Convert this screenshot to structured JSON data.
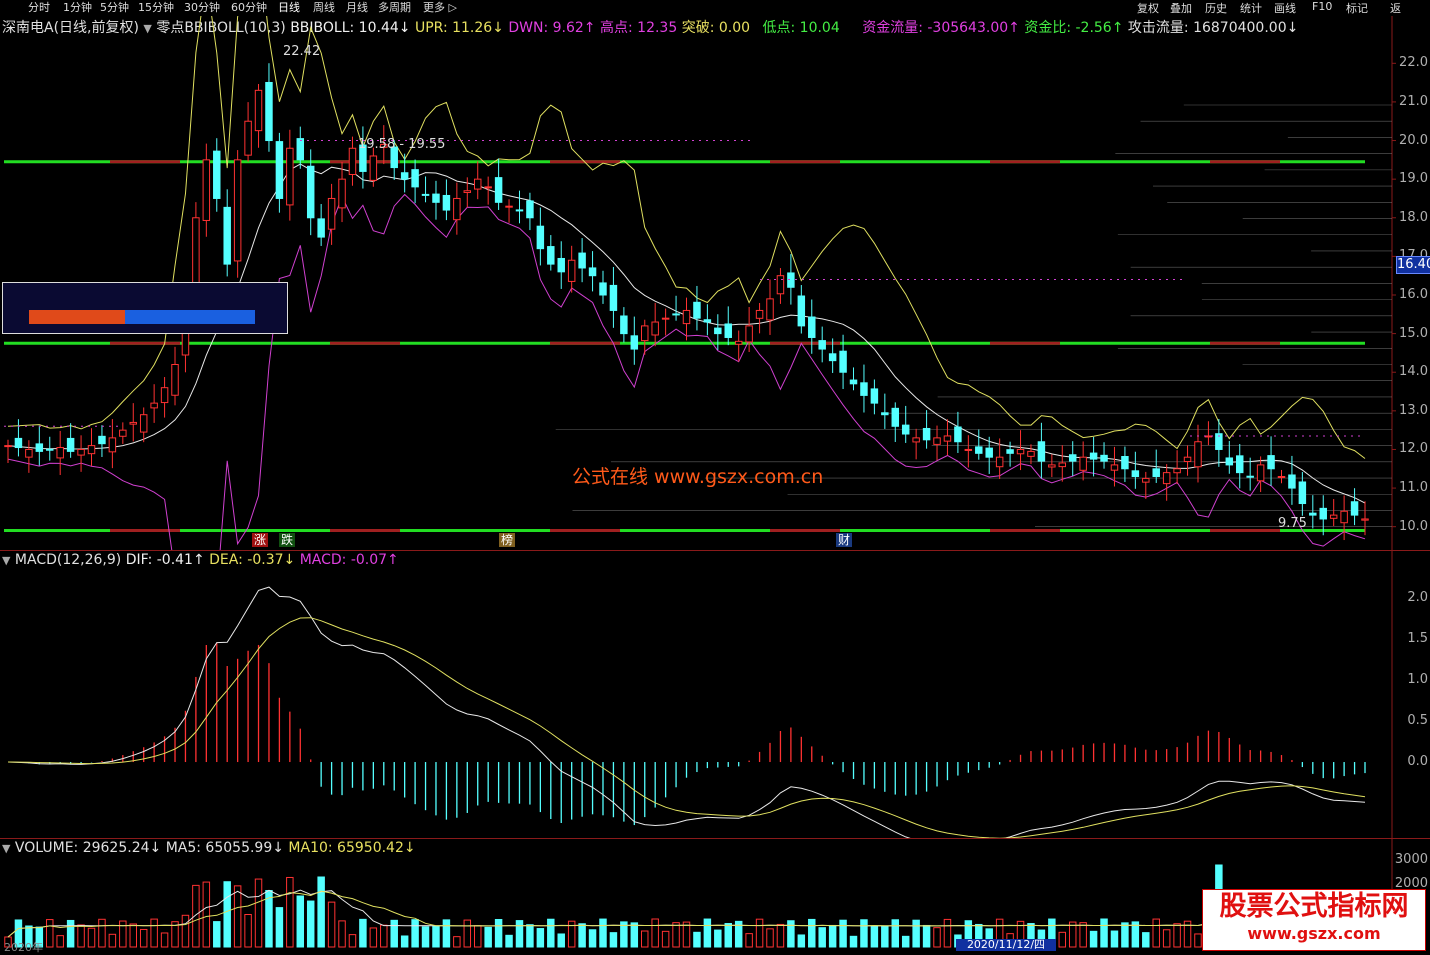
{
  "toolbar": {
    "periods": [
      "分时",
      "1分钟",
      "5分钟",
      "15分钟",
      "30分钟",
      "60分钟",
      "日线",
      "周线",
      "月线",
      "多周期",
      "更多"
    ],
    "active": "日线",
    "right": [
      "复权",
      "叠加",
      "历史",
      "统计",
      "画线",
      "F10",
      "标记",
      "返"
    ]
  },
  "main_header": {
    "stock": "深南电A(日线,前复权)",
    "indicator": "零点BBIBOLL(10,3)",
    "bbiboll": "BBIBOLL: 10.44↓",
    "upr": "UPR: 11.26↓",
    "dwn": "DWN: 9.62↑",
    "high": "高点: 12.35",
    "breakout": "突破: 0.00",
    "low": "低点: 10.04",
    "fund_flow": "资金流量: -305643.00↑",
    "fund_ratio": "资金比: -2.56↑",
    "attack_flow": "攻击流量: 16870400.00↓"
  },
  "main_annotations": {
    "peak": "22.42",
    "range": "19.58 - 19.55",
    "trough": "9.75",
    "current_price": "16.40",
    "markers": [
      "涨",
      "跌",
      "榜",
      "财"
    ]
  },
  "price_axis": [
    "22.0",
    "21.0",
    "20.0",
    "19.0",
    "18.0",
    "17.0",
    "16.0",
    "15.0",
    "14.0",
    "13.0",
    "12.0",
    "11.0",
    "10.0"
  ],
  "macd_header": {
    "title": "MACD(12,26,9)",
    "dif": "DIF: -0.41↑",
    "dea": "DEA: -0.37↓",
    "macd": "MACD: -0.07↑"
  },
  "macd_axis": [
    "2.0",
    "1.5",
    "1.0",
    "0.5",
    "0.0"
  ],
  "volume_header": {
    "volume": "VOLUME: 29625.24↓",
    "ma5": "MA5: 65055.99↓",
    "ma10": "MA10: 65950.42↓"
  },
  "volume_axis": [
    "3000",
    "2000"
  ],
  "date_axis": {
    "year": "2020年",
    "highlight": "2020/11/12/四"
  },
  "watermark": "公式在线 www.gszx.com.cn",
  "brand": {
    "title": "股票公式指标网",
    "url": "www.gszx.com"
  },
  "colors": {
    "up": "#ff3232",
    "down": "#54ffff",
    "green": "#22dd22",
    "magenta": "#d040d0",
    "yellow": "#e0e060",
    "white": "#e8e8e8"
  },
  "chart_data": [
    {
      "type": "candlestick",
      "title": "深南电A(日线,前复权)",
      "ylim": [
        9.5,
        22.5
      ],
      "series_count": 125,
      "high_point": 22.42,
      "low_point": 9.75,
      "horizontal_levels": [
        19.45,
        14.75,
        9.9
      ],
      "closes": [
        12.1,
        12.05,
        12.0,
        11.95,
        12.0,
        12.05,
        11.95,
        12.0,
        12.1,
        12.15,
        12.3,
        12.5,
        12.7,
        12.9,
        13.2,
        13.6,
        14.2,
        15.5,
        18.0,
        19.5,
        18.5,
        16.8,
        19.5,
        20.5,
        21.3,
        20.0,
        18.5,
        19.8,
        19.5,
        18.0,
        17.5,
        18.5,
        19.0,
        19.8,
        19.2,
        19.6,
        19.9,
        19.3,
        19.0,
        18.8,
        18.6,
        18.4,
        18.2,
        18.5,
        18.7,
        19.0,
        18.8,
        18.4,
        18.3,
        18.2,
        18.0,
        17.2,
        16.8,
        16.6,
        16.9,
        16.7,
        16.5,
        16.0,
        15.6,
        15.0,
        14.6,
        15.2,
        15.3,
        15.4,
        15.5,
        15.6,
        15.4,
        15.3,
        15.0,
        14.9,
        14.8,
        15.2,
        15.6,
        15.9,
        16.5,
        16.2,
        15.2,
        14.9,
        14.6,
        14.3,
        14.0,
        13.7,
        13.4,
        13.2,
        12.9,
        12.6,
        12.4,
        12.3,
        12.25,
        12.3,
        12.35,
        12.2,
        12.0,
        11.9,
        11.8,
        11.8,
        11.9,
        12.0,
        11.95,
        11.7,
        11.6,
        11.65,
        11.7,
        11.8,
        11.75,
        11.7,
        11.6,
        11.5,
        11.3,
        11.25,
        11.3,
        11.4,
        11.5,
        11.8,
        12.2,
        12.35,
        12.0,
        11.6,
        11.4,
        11.3,
        11.6,
        11.5,
        11.3,
        11.0,
        10.6,
        10.3,
        10.2,
        10.3,
        10.4,
        10.3,
        10.2
      ]
    },
    {
      "type": "bar",
      "title": "MACD(12,26,9)",
      "ylim": [
        -0.9,
        2.3
      ],
      "dif": -0.41,
      "dea": -0.37,
      "macd": -0.07
    },
    {
      "type": "bar",
      "title": "VOLUME",
      "volume": 29625.24,
      "ma5": 65055.99,
      "ma10": 65950.42
    }
  ]
}
